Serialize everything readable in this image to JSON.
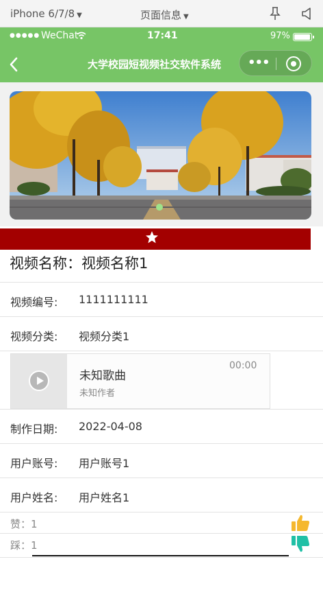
{
  "simulator": {
    "device": "iPhone 6/7/8",
    "page_menu": "页面信息"
  },
  "status_bar": {
    "signal": "●●●●●",
    "carrier": "WeChat",
    "time": "17:41",
    "battery": "97%"
  },
  "navbar": {
    "title": "大学校园短视频社交软件系统",
    "capsule_dots": "•••"
  },
  "colors": {
    "theme_green": "#77c566",
    "favorite_bar": "#a30000",
    "thumb_up": "#f5b82e",
    "thumb_down": "#20c0a6"
  },
  "detail": {
    "title": "视频名称：视频名称1",
    "rows": [
      {
        "label": "视频编号:",
        "value": "1111111111"
      },
      {
        "label": "视频分类:",
        "value": "视频分类1"
      },
      {
        "label": "制作日期:",
        "value": "2022-04-08"
      },
      {
        "label": "用户账号:",
        "value": "用户账号1"
      },
      {
        "label": "用户姓名:",
        "value": "用户姓名1"
      }
    ]
  },
  "audio": {
    "song": "未知歌曲",
    "author": "未知作者",
    "duration": "00:00"
  },
  "votes": {
    "like": "赞：1",
    "dislike": "踩：1"
  },
  "icons": {
    "favorite": "star-icon",
    "like": "thumbs-up-icon",
    "dislike": "thumbs-down-icon",
    "play": "play-icon"
  }
}
